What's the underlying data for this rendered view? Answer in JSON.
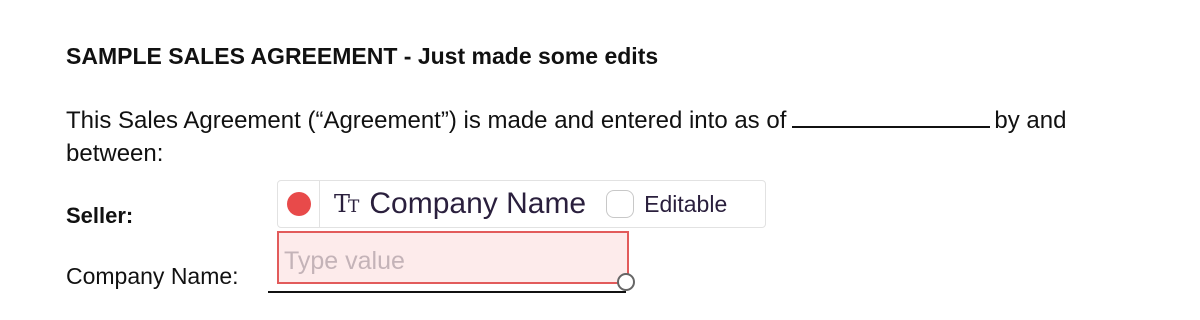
{
  "document": {
    "title": "SAMPLE SALES AGREEMENT - Just made some edits",
    "intro_text": "This Sales Agreement (“Agreement”) is made and entered into as of",
    "intro_tail": "by and between:",
    "seller_label": "Seller:",
    "company_name_label": "Company Name:"
  },
  "field_toolbar": {
    "status_color": "#e84a4a",
    "type_icon": "text-type-icon",
    "type_icon_glyph_large": "T",
    "type_icon_glyph_small": "T",
    "field_name": "Company Name",
    "editable_label": "Editable",
    "editable_checked": false
  },
  "field_input": {
    "placeholder": "Type value",
    "value": "",
    "border_color": "#e25b5b",
    "background_color": "#fdebeb"
  }
}
